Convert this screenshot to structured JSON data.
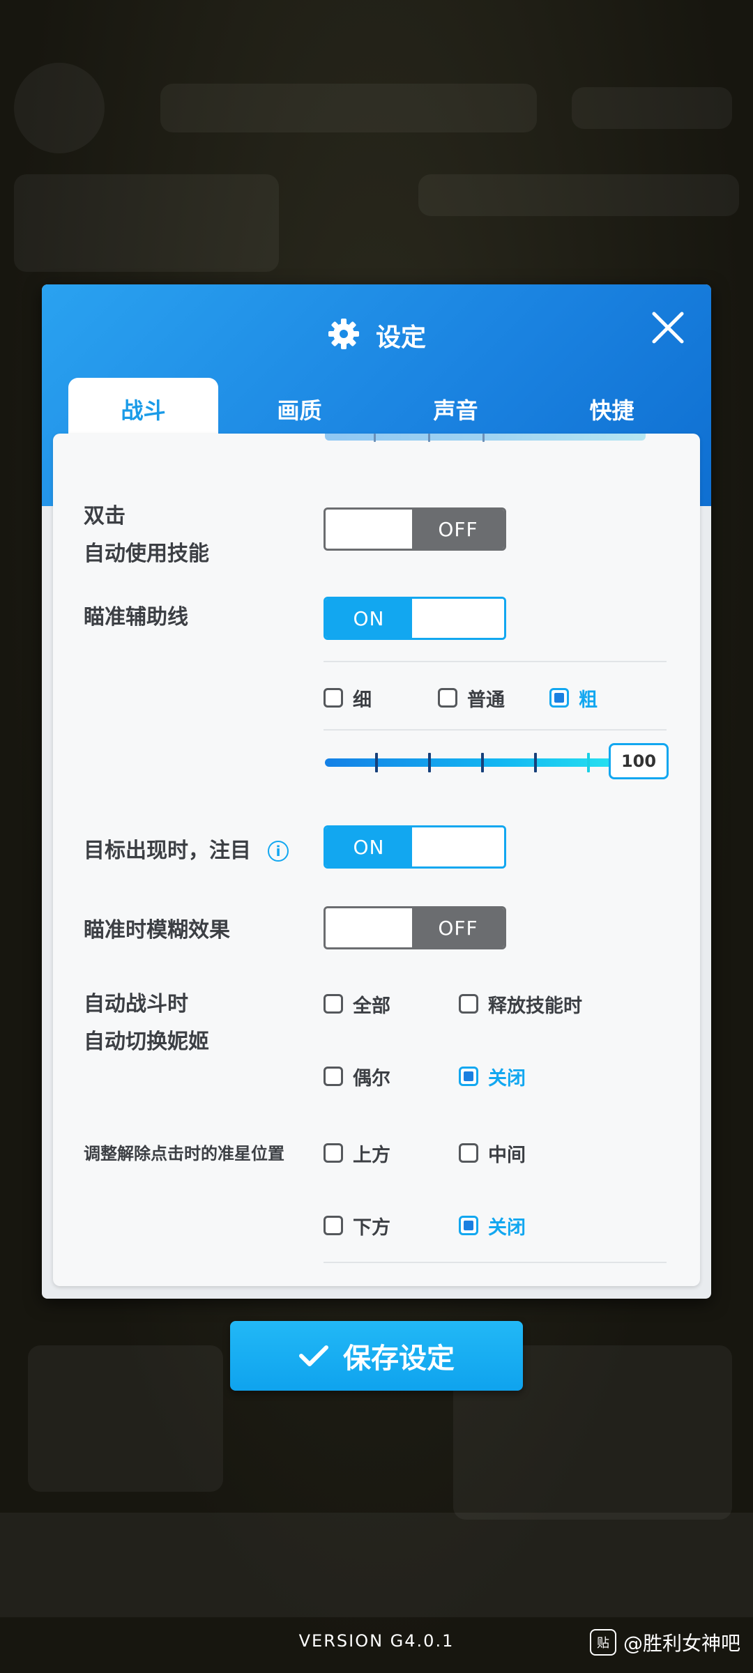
{
  "dialog": {
    "title": "设定",
    "tabs": [
      {
        "label": "战斗",
        "active": true
      },
      {
        "label": "画质",
        "active": false
      },
      {
        "label": "声音",
        "active": false
      },
      {
        "label": "快捷",
        "active": false
      }
    ]
  },
  "settings": {
    "double_tap": {
      "label_line1": "双击",
      "label_line2": "自动使用技能",
      "state": "OFF"
    },
    "aim_line": {
      "label": "瞄准辅助线",
      "state": "ON",
      "thickness_options": [
        {
          "label": "细",
          "checked": false
        },
        {
          "label": "普通",
          "checked": false
        },
        {
          "label": "粗",
          "checked": true
        }
      ],
      "slider_value": "100",
      "slider_fraction": 1.0
    },
    "target_focus": {
      "label": "目标出现时，注目",
      "info_icon": "i",
      "state": "ON"
    },
    "aim_blur": {
      "label": "瞄准时模糊效果",
      "state": "OFF"
    },
    "auto_switch": {
      "label_line1": "自动战斗时",
      "label_line2": "自动切换妮姬",
      "options": [
        {
          "label": "全部",
          "checked": false
        },
        {
          "label": "释放技能时",
          "checked": false
        },
        {
          "label": "偶尔",
          "checked": false
        },
        {
          "label": "关闭",
          "checked": true
        }
      ]
    },
    "crosshair_pos": {
      "label": "调整解除点击时的准星位置",
      "options": [
        {
          "label": "上方",
          "checked": false
        },
        {
          "label": "中间",
          "checked": false
        },
        {
          "label": "下方",
          "checked": false
        },
        {
          "label": "关闭",
          "checked": true
        }
      ]
    }
  },
  "save_button": {
    "label": "保存设定",
    "icon": "check-icon"
  },
  "footer": {
    "version": "VERSION  G4.0.1",
    "watermark_text": "@胜利女神吧",
    "watermark_logo": "贴"
  },
  "colors": {
    "accent": "#12a7f0",
    "header": "#1a82e0",
    "off_grey": "#6b6d70"
  }
}
